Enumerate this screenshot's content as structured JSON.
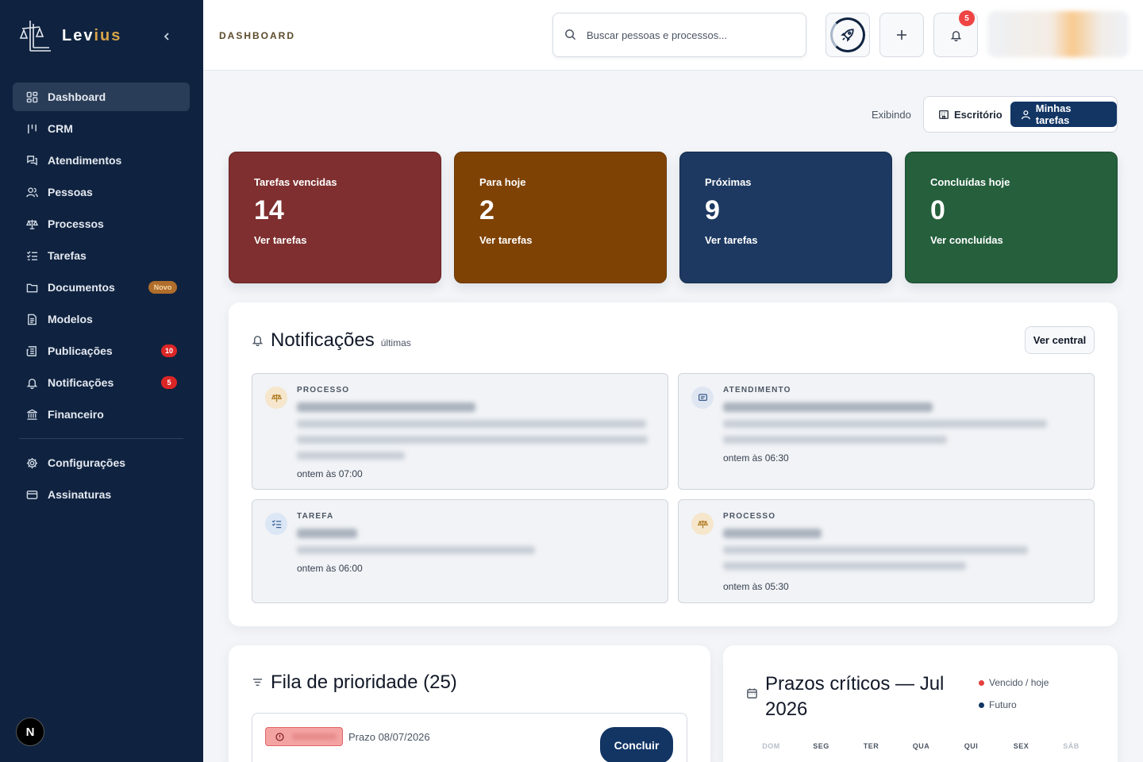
{
  "brand": {
    "name_main": "Lev",
    "name_accent": "ius"
  },
  "sidebar": {
    "items": [
      {
        "label": "Dashboard",
        "icon": "grid-icon",
        "active": true
      },
      {
        "label": "CRM",
        "icon": "kanban-icon"
      },
      {
        "label": "Atendimentos",
        "icon": "chat-icon"
      },
      {
        "label": "Pessoas",
        "icon": "users-icon"
      },
      {
        "label": "Processos",
        "icon": "scale-icon"
      },
      {
        "label": "Tarefas",
        "icon": "checklist-icon"
      },
      {
        "label": "Documentos",
        "icon": "folder-icon",
        "badge": "Novo"
      },
      {
        "label": "Modelos",
        "icon": "file-icon"
      },
      {
        "label": "Publicações",
        "icon": "newspaper-icon",
        "badge": "10"
      },
      {
        "label": "Notificações",
        "icon": "bell-icon",
        "badge": "5"
      },
      {
        "label": "Financeiro",
        "icon": "bank-icon"
      }
    ],
    "bottom_items": [
      {
        "label": "Configurações",
        "icon": "gear-icon"
      },
      {
        "label": "Assinaturas",
        "icon": "card-icon"
      }
    ],
    "avatar_letter": "N"
  },
  "topbar": {
    "title": "DASHBOARD",
    "search_placeholder": "Buscar pessoas e processos...",
    "bell_badge": "5"
  },
  "view_toggle": {
    "label": "Exibindo",
    "option_office": "Escritório",
    "option_mine": "Minhas tarefas",
    "selected": "Minhas tarefas"
  },
  "stats": [
    {
      "label": "Tarefas vencidas",
      "value": "14",
      "link": "Ver tarefas",
      "color": "#7f2f2f"
    },
    {
      "label": "Para hoje",
      "value": "2",
      "link": "Ver tarefas",
      "color": "#7f4205"
    },
    {
      "label": "Próximas",
      "value": "9",
      "link": "Ver tarefas",
      "color": "#1d3961"
    },
    {
      "label": "Concluídas hoje",
      "value": "0",
      "link": "Ver concluídas",
      "color": "#255f3c"
    }
  ],
  "notifications": {
    "title": "Notificações",
    "subtitle": "últimas",
    "button": "Ver central",
    "items": [
      {
        "kind": "PROCESSO",
        "time": "ontem às 07:00",
        "icon": "scale-icon"
      },
      {
        "kind": "ATENDIMENTO",
        "time": "ontem às 06:30",
        "icon": "chat-icon"
      },
      {
        "kind": "TAREFA",
        "time": "ontem às 06:00",
        "icon": "checklist-icon"
      },
      {
        "kind": "PROCESSO",
        "time": "ontem às 05:30",
        "icon": "scale-icon"
      }
    ]
  },
  "fila": {
    "title": "Fila de prioridade (25)",
    "item_deadline": "Prazo 08/07/2026",
    "item_button": "Concluir"
  },
  "prazos": {
    "title_line1": "Prazos críticos — Jul",
    "title_line2": "2026",
    "legend_overdue": "Vencido / hoje",
    "legend_future": "Futuro",
    "weekdays": [
      "DOM",
      "SEG",
      "TER",
      "QUA",
      "QUI",
      "SEX",
      "SÁB"
    ],
    "overdue_color": "#e53e3e",
    "future_color": "#123564"
  },
  "colors": {
    "sidebar_bg": "#0f2340",
    "primary": "#123564",
    "brand_accent": "#d8a347"
  }
}
